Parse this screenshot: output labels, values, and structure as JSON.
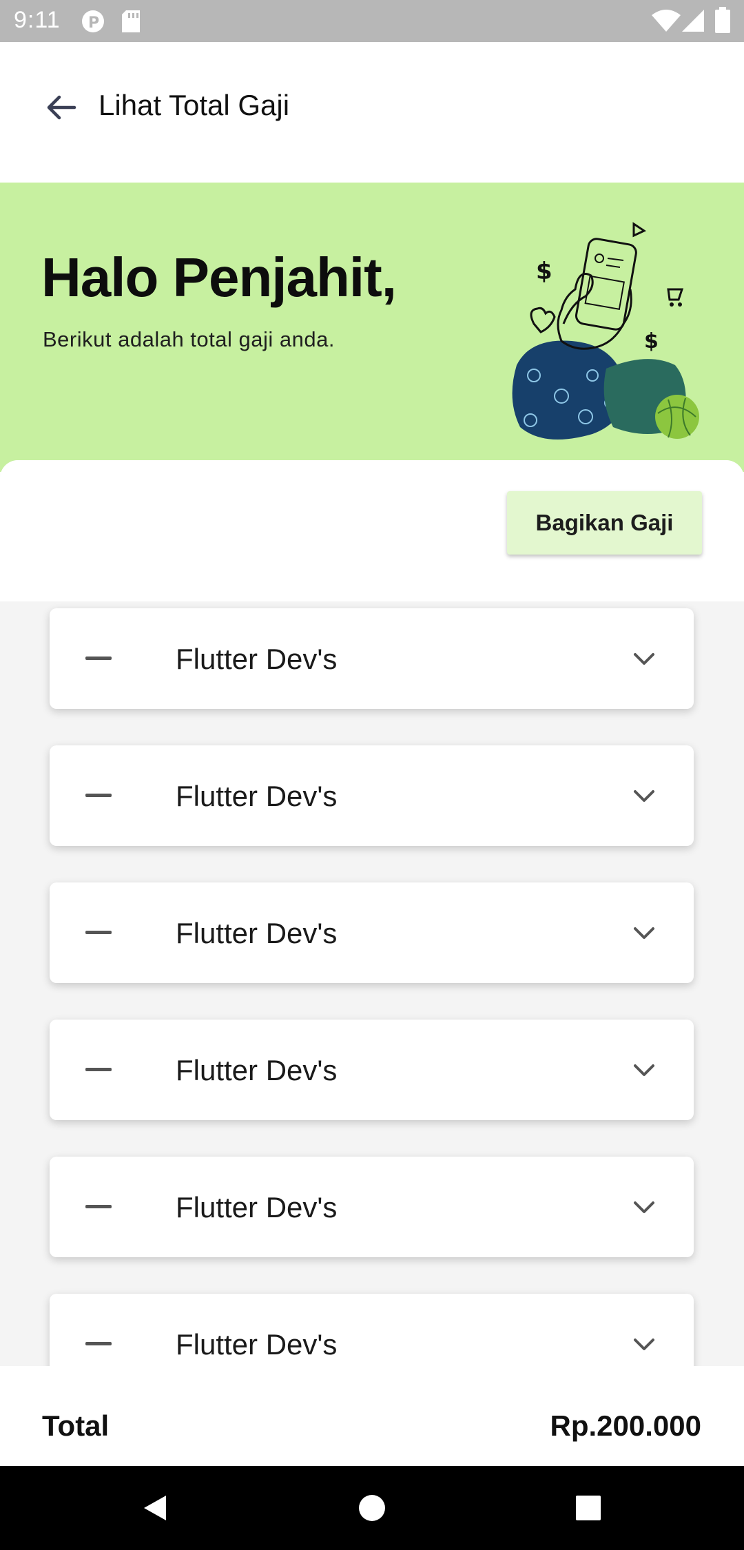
{
  "status_bar": {
    "time": "9:11",
    "icons": [
      "p-badge-icon",
      "sd-card-icon",
      "wifi-icon",
      "signal-icon",
      "battery-icon"
    ]
  },
  "app_bar": {
    "back_icon": "arrow-left-icon",
    "title": "Lihat Total Gaji"
  },
  "hero": {
    "title": "Halo Penjahit,",
    "subtitle": "Berikut adalah total gaji anda.",
    "illustration": "hand-holding-phone-money-illustration",
    "background": "#c7f0a0"
  },
  "actions": {
    "share_label": "Bagikan Gaji"
  },
  "cards": [
    {
      "label": "Flutter Dev's"
    },
    {
      "label": "Flutter Dev's"
    },
    {
      "label": "Flutter Dev's"
    },
    {
      "label": "Flutter Dev's"
    },
    {
      "label": "Flutter Dev's"
    },
    {
      "label": "Flutter Dev's"
    }
  ],
  "total": {
    "label": "Total",
    "value": "Rp.200.000"
  },
  "nav_bar": {
    "buttons": [
      "back-triangle-icon",
      "home-circle-icon",
      "recents-square-icon"
    ]
  }
}
